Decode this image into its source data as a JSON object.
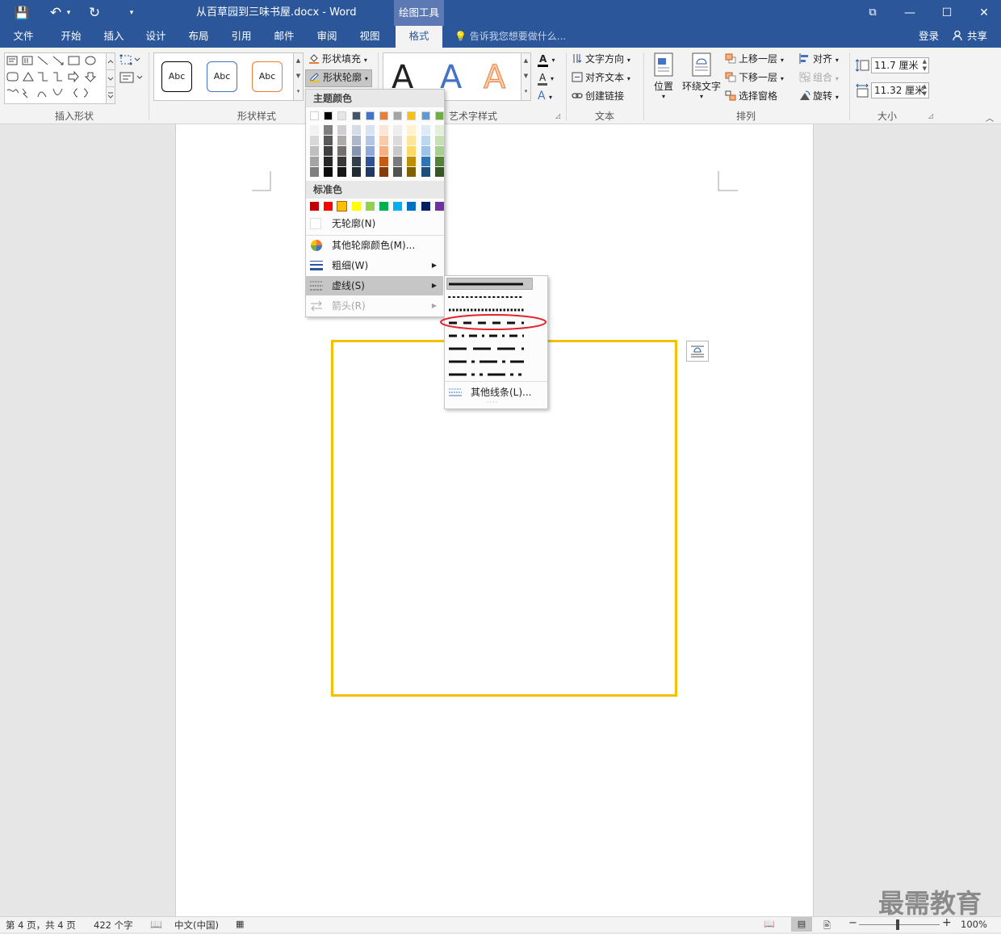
{
  "window": {
    "title": "从百草园到三味书屋.docx - Word",
    "context_tab_group": "绘图工具",
    "controls": {
      "restore": "⧉",
      "minimize": "—",
      "maximize": "☐",
      "close": "✕"
    }
  },
  "qat": {
    "save": "💾",
    "undo": "↶",
    "undo_dropdown": "▾",
    "redo": "↻",
    "customize": "▾"
  },
  "tabs": [
    "文件",
    "开始",
    "插入",
    "设计",
    "布局",
    "引用",
    "邮件",
    "审阅",
    "视图",
    "格式"
  ],
  "active_tab": "格式",
  "tell_me": "告诉我您想要做什么...",
  "account": {
    "signin": "登录",
    "share": "共享"
  },
  "ribbon": {
    "insert_shapes": {
      "label": "插入形状"
    },
    "shape_styles": {
      "label": "形状样式",
      "samples": [
        {
          "text": "Abc",
          "border": "#000000"
        },
        {
          "text": "Abc",
          "border": "#4472c4"
        },
        {
          "text": "Abc",
          "border": "#ed7d31"
        }
      ],
      "fill": "形状填充",
      "outline": "形状轮廓"
    },
    "wordart": {
      "label": "艺术字样式",
      "letters": [
        {
          "char": "A",
          "color": "#000000"
        },
        {
          "char": "A",
          "color": "#4472c4"
        },
        {
          "char": "A",
          "color": "#f4b183"
        }
      ],
      "text_fill_glyph": "A",
      "text_outline_glyph": "A",
      "text_effects_glyph": "A"
    },
    "text": {
      "label": "文本",
      "direction": "文字方向",
      "align": "对齐文本",
      "link": "创建链接"
    },
    "arrange": {
      "label": "排列",
      "position": "位置",
      "wrap": "环绕文字",
      "bring_forward": "上移一层",
      "send_backward": "下移一层",
      "selection_pane": "选择窗格",
      "align": "对齐",
      "group": "组合",
      "rotate": "旋转"
    },
    "size": {
      "label": "大小",
      "height": "11.7 厘米",
      "width": "11.32 厘米"
    }
  },
  "outline_menu": {
    "theme_header": "主题颜色",
    "theme_top": [
      "#ffffff",
      "#000000",
      "#e7e6e6",
      "#44546a",
      "#4472c4",
      "#ed7d31",
      "#a5a5a5",
      "#ffc000",
      "#5b9bd5",
      "#70ad47"
    ],
    "theme_shades": [
      [
        "#f2f2f2",
        "#7f7f7f",
        "#d0cece",
        "#d6dce4",
        "#d9e2f3",
        "#fbe5d5",
        "#ededed",
        "#fff2cc",
        "#deebf6",
        "#e2efd9"
      ],
      [
        "#d8d8d8",
        "#595959",
        "#aeabab",
        "#adb9ca",
        "#b4c6e7",
        "#f7cbac",
        "#dbdbdb",
        "#fee599",
        "#bdd7ee",
        "#c5e0b3"
      ],
      [
        "#bfbfbf",
        "#3f3f3f",
        "#757070",
        "#8496b0",
        "#8eaadb",
        "#f4b183",
        "#c9c9c9",
        "#ffd965",
        "#9dc3e6",
        "#a8d08d"
      ],
      [
        "#a5a5a5",
        "#262626",
        "#3a3838",
        "#323f4f",
        "#2f5496",
        "#c55a11",
        "#7b7b7b",
        "#bf8f00",
        "#2e75b5",
        "#538135"
      ],
      [
        "#7f7f7f",
        "#0c0c0c",
        "#171616",
        "#222a35",
        "#1f3864",
        "#833c0b",
        "#525252",
        "#7f6000",
        "#1e4e79",
        "#375623"
      ]
    ],
    "standard_header": "标准色",
    "standard": [
      "#c00000",
      "#ff0000",
      "#ffc000",
      "#ffff00",
      "#92d050",
      "#00b050",
      "#00b0f0",
      "#0070c0",
      "#002060",
      "#7030a0"
    ],
    "no_outline": "无轮廓(N)",
    "more_colors": "其他轮廓颜色(M)...",
    "weight": "粗细(W)",
    "dashes": "虚线(S)",
    "arrows": "箭头(R)"
  },
  "dash_menu": {
    "styles": [
      "solid",
      "round-dot",
      "square-dot",
      "dash",
      "dash-dot",
      "long-dash",
      "long-dash-dot",
      "long-dash-dot-dot"
    ],
    "more_lines": "其他线条(L)...",
    "grip": "····"
  },
  "shape": {
    "border_color": "#f5c000"
  },
  "watermark": "最需教育",
  "status": {
    "page": "第 4 页，共 4 页",
    "words": "422 个字",
    "language": "中文(中国)",
    "zoom_out": "−",
    "zoom_in": "+",
    "zoom": "100%",
    "zoom_level": 1.0
  }
}
